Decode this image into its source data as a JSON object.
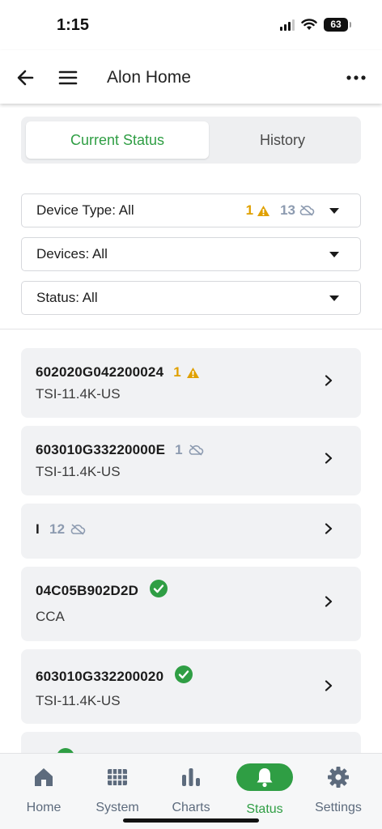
{
  "status_bar": {
    "time": "1:15",
    "battery": "63"
  },
  "header": {
    "title": "Alon Home"
  },
  "segmented": {
    "current": "Current Status",
    "history": "History"
  },
  "filters": {
    "device_type": "Device Type:  All",
    "devices": "Devices:  All",
    "status": "Status:  All",
    "warning_count": "1",
    "offline_count": "13"
  },
  "devices": [
    {
      "name": "602020G042200024",
      "model": "TSI-11.4K-US",
      "badge": "1",
      "badge_type": "warning"
    },
    {
      "name": "603010G33220000E",
      "model": "TSI-11.4K-US",
      "badge": "1",
      "badge_type": "offline"
    },
    {
      "name": "I",
      "model": "",
      "badge": "12",
      "badge_type": "offline"
    },
    {
      "name": "04C05B902D2D",
      "model": "CCA",
      "badge": "",
      "badge_type": "ok"
    },
    {
      "name": "603010G332200020",
      "model": "TSI-11.4K-US",
      "badge": "",
      "badge_type": "ok"
    }
  ],
  "tabs": [
    {
      "label": "Home",
      "icon": "home-icon"
    },
    {
      "label": "System",
      "icon": "grid-icon"
    },
    {
      "label": "Charts",
      "icon": "bar-chart-icon"
    },
    {
      "label": "Status",
      "icon": "bell-icon"
    },
    {
      "label": "Settings",
      "icon": "gear-icon"
    }
  ],
  "colors": {
    "accent": "#2f9e44",
    "warning": "#e0a000",
    "offline": "#8d9bb0"
  }
}
